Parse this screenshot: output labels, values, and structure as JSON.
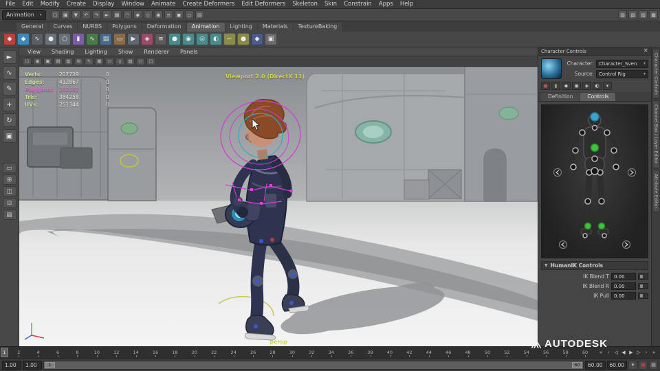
{
  "colors": {
    "effector_green": "#3fc43f",
    "effector_blue": "#3aa4cc",
    "rig_magenta": "#d83fd8",
    "hud_green": "#c6dc8a",
    "hud_magenta": "#e868d8",
    "viewport_label_yellow": "#d2d24e"
  },
  "menubar": {
    "items": [
      "File",
      "Edit",
      "Modify",
      "Create",
      "Display",
      "Window",
      "Animate",
      "Create Deformers",
      "Edit Deformers",
      "Skeleton",
      "Skin",
      "Constrain",
      "Apps",
      "Help"
    ]
  },
  "statusline": {
    "menuset": "Animation",
    "menuset_arrow": "▾",
    "left_icons": [
      {
        "name": "new-scene-icon",
        "glyph": "▢"
      },
      {
        "name": "open-scene-icon",
        "glyph": "▣"
      },
      {
        "name": "save-scene-icon",
        "glyph": "▼"
      },
      {
        "name": "undo-icon",
        "glyph": "↶"
      },
      {
        "name": "redo-icon",
        "glyph": "↷"
      },
      {
        "name": "select-mode-icon",
        "glyph": "►"
      },
      {
        "name": "snap-to-grid-icon",
        "glyph": "▦"
      },
      {
        "name": "snap-to-curve-icon",
        "glyph": "◠"
      },
      {
        "name": "snap-to-point-icon",
        "glyph": "◆"
      },
      {
        "name": "snap-to-plane-icon",
        "glyph": "◇"
      },
      {
        "name": "make-live-icon",
        "glyph": "◉"
      },
      {
        "name": "construction-history-icon",
        "glyph": "≡"
      },
      {
        "name": "render-frame-icon",
        "glyph": "◼"
      },
      {
        "name": "ipr-render-icon",
        "glyph": "◻"
      },
      {
        "name": "render-settings-icon",
        "glyph": "▤"
      }
    ],
    "right_icons": [
      {
        "name": "attribute-editor-toggle-icon",
        "glyph": "▥"
      },
      {
        "name": "tool-settings-toggle-icon",
        "glyph": "▧"
      },
      {
        "name": "channel-box-toggle-icon",
        "glyph": "▨"
      },
      {
        "name": "workspace-toggle-icon",
        "glyph": "▩"
      }
    ]
  },
  "shelf": {
    "active_tab": "Animation",
    "tabs": [
      "General",
      "Curves",
      "NURBS",
      "Polygons",
      "Deformation",
      "Animation",
      "Lighting",
      "Materials",
      "TextureBaking"
    ],
    "icons": [
      {
        "name": "shelf-set-key-icon",
        "glyph": "◆",
        "color": "#b8433c"
      },
      {
        "name": "shelf-set-breakdown-icon",
        "glyph": "◆",
        "color": "#3c8ab8"
      },
      {
        "name": "shelf-motion-trail-icon",
        "glyph": "∿",
        "color": "#5a5f66"
      },
      {
        "name": "shelf-ghost-icon",
        "glyph": "●",
        "color": "#6a7078"
      },
      {
        "name": "shelf-unghost-icon",
        "glyph": "○",
        "color": "#6a7078"
      },
      {
        "name": "shelf-create-clip-icon",
        "glyph": "▮",
        "color": "#7a5fa0"
      },
      {
        "name": "shelf-graph-editor-icon",
        "glyph": "∿",
        "color": "#4a7a4a"
      },
      {
        "name": "shelf-dope-sheet-icon",
        "glyph": "▤",
        "color": "#4a6a8a"
      },
      {
        "name": "shelf-trax-editor-icon",
        "glyph": "▭",
        "color": "#8a6a4a"
      },
      {
        "name": "shelf-playblast-icon",
        "glyph": "▶",
        "color": "#5f6670"
      },
      {
        "name": "shelf-set-driven-key-icon",
        "glyph": "◈",
        "color": "#9a4a6a"
      },
      {
        "name": "shelf-expression-icon",
        "glyph": "≡",
        "color": "#5a5a5a"
      },
      {
        "name": "shelf-point-constraint-icon",
        "glyph": "●",
        "color": "#4a8a8a"
      },
      {
        "name": "shelf-aim-constraint-icon",
        "glyph": "◉",
        "color": "#4a8a8a"
      },
      {
        "name": "shelf-orient-constraint-icon",
        "glyph": "◎",
        "color": "#4a8a8a"
      },
      {
        "name": "shelf-parent-constraint-icon",
        "glyph": "◐",
        "color": "#4a8a8a"
      },
      {
        "name": "shelf-ik-handle-icon",
        "glyph": "⌐",
        "color": "#8a8a4a"
      },
      {
        "name": "shelf-joint-icon",
        "glyph": "●",
        "color": "#8a8a4a"
      },
      {
        "name": "shelf-hik-character-icon",
        "glyph": "◆",
        "color": "#4a5a8a"
      },
      {
        "name": "shelf-anim-snapshot-icon",
        "glyph": "▣",
        "color": "#6a6a6a"
      }
    ]
  },
  "toolbox": {
    "tools": [
      {
        "name": "select-tool-icon",
        "glyph": "►"
      },
      {
        "name": "lasso-tool-icon",
        "glyph": "∿"
      },
      {
        "name": "paint-select-tool-icon",
        "glyph": "✎"
      },
      {
        "name": "move-tool-icon",
        "glyph": "+"
      },
      {
        "name": "rotate-tool-icon",
        "glyph": "↻"
      },
      {
        "name": "scale-tool-icon",
        "glyph": "▣"
      }
    ],
    "layouts": [
      {
        "name": "single-pane-layout-icon",
        "glyph": "▭"
      },
      {
        "name": "four-pane-layout-icon",
        "glyph": "⊞"
      },
      {
        "name": "persp-outliner-layout-icon",
        "glyph": "◫"
      },
      {
        "name": "persp-graph-layout-icon",
        "glyph": "⊟"
      },
      {
        "name": "hypershade-layout-icon",
        "glyph": "▤"
      }
    ]
  },
  "viewport": {
    "menu": [
      "View",
      "Shading",
      "Lighting",
      "Show",
      "Renderer",
      "Panels"
    ],
    "toolbar_icons": [
      {
        "name": "select-camera-icon",
        "glyph": "▢"
      },
      {
        "name": "lock-camera-icon",
        "glyph": "◉"
      },
      {
        "name": "camera-attributes-icon",
        "glyph": "▣"
      },
      {
        "name": "bookmarks-icon",
        "glyph": "▤"
      },
      {
        "name": "image-plane-icon",
        "glyph": "▥"
      },
      {
        "name": "pan-zoom-icon",
        "glyph": "⊞"
      },
      {
        "name": "grease-pencil-icon",
        "glyph": "✎"
      },
      {
        "name": "grid-icon",
        "glyph": "▦"
      },
      {
        "name": "film-gate-icon",
        "glyph": "▭"
      },
      {
        "name": "resolution-gate-icon",
        "glyph": "▯"
      },
      {
        "name": "gate-mask-icon",
        "glyph": "▧"
      },
      {
        "name": "safe-action-icon",
        "glyph": "◻"
      },
      {
        "name": "safe-title-icon",
        "glyph": "□"
      }
    ],
    "hud_rows": [
      {
        "label": "Verts:",
        "value": "207739",
        "sel": "0",
        "color": "#c6dc8a",
        "vcolor": "#e4e4d2"
      },
      {
        "label": "Edges:",
        "value": "412867",
        "sel": "0",
        "color": "#c6dc8a",
        "vcolor": "#e4e4d2"
      },
      {
        "label": "Polygons:",
        "value": "202082",
        "sel": "0",
        "color": "#e868d8",
        "vcolor": "#e868d8"
      },
      {
        "label": "Tris:",
        "value": "384258",
        "sel": "0",
        "color": "#c6dc8a",
        "vcolor": "#e4e4d2"
      },
      {
        "label": "UVs:",
        "value": "251344",
        "sel": "0",
        "color": "#c6dc8a",
        "vcolor": "#e4e4d2"
      }
    ],
    "renderer_label": "Viewport 2.0 (DirectX 11)",
    "camera_label": "persp"
  },
  "character_controls": {
    "title": "Character Controls",
    "close_glyph": "×",
    "character_label": "Character:",
    "character_value": "Character_Sven",
    "source_label": "Source:",
    "source_value": "Control Rig",
    "dropdown_glyph": "▾",
    "toolbar_icons": [
      {
        "name": "edit-character-icon",
        "glyph": "●",
        "color": "#c05050"
      },
      {
        "name": "lock-character-icon",
        "glyph": "▮",
        "color": "#b0a050"
      },
      {
        "name": "skeleton-icon",
        "glyph": "◆",
        "color": "#cccccc"
      },
      {
        "name": "control-rig-icon",
        "glyph": "◉",
        "color": "#cccccc"
      },
      {
        "name": "keying-mode-icon",
        "glyph": "◈",
        "color": "#cccccc"
      },
      {
        "name": "mirror-icon",
        "glyph": "◐",
        "color": "#cccccc"
      },
      {
        "name": "hik-options-icon",
        "glyph": "▾",
        "color": "#cccccc"
      }
    ],
    "tabs": [
      "Definition",
      "Controls"
    ],
    "active_tab": "Controls",
    "humanik": {
      "collapse_glyph": "▼",
      "title": "HumanIK Controls",
      "fields": [
        {
          "label": "IK Blend T",
          "value": "0.00"
        },
        {
          "label": "IK Blend R",
          "value": "0.00"
        },
        {
          "label": "IK Pull",
          "value": "0.00"
        }
      ]
    }
  },
  "side_tabs": [
    "Character Controls",
    "Channel Box / Layer Editor",
    "Attribute Editor"
  ],
  "timeline": {
    "current_frame": "1",
    "ticks": [
      2,
      4,
      6,
      8,
      10,
      12,
      14,
      16,
      18,
      20,
      22,
      24,
      26,
      28,
      30,
      32,
      34,
      36,
      38,
      40,
      42,
      44,
      46,
      48,
      50,
      52,
      54,
      56,
      58,
      60
    ]
  },
  "playback": {
    "buttons": [
      {
        "name": "go-to-start-button",
        "glyph": "«"
      },
      {
        "name": "step-back-frame-button",
        "glyph": "‹"
      },
      {
        "name": "step-back-key-button",
        "glyph": "◁"
      },
      {
        "name": "play-backwards-button",
        "glyph": "◀"
      },
      {
        "name": "play-forward-button",
        "glyph": "▶"
      },
      {
        "name": "step-forward-key-button",
        "glyph": "▷"
      },
      {
        "name": "step-forward-frame-button",
        "glyph": "›"
      },
      {
        "name": "go-to-end-button",
        "glyph": "»"
      }
    ]
  },
  "rangebar": {
    "anim_start": "1.00",
    "play_start": "1.00",
    "handle_start": "1",
    "handle_end": "60",
    "play_end": "60.00",
    "anim_end": "60.00",
    "icons": [
      {
        "name": "character-set-menu-icon",
        "glyph": "▾",
        "color": "#cccccc"
      },
      {
        "name": "auto-keyframe-icon",
        "glyph": "●",
        "color": "#c23c3c"
      },
      {
        "name": "animation-preferences-icon",
        "glyph": "▤",
        "color": "#cccccc"
      }
    ]
  },
  "brand": {
    "label": "AUTODESK"
  }
}
